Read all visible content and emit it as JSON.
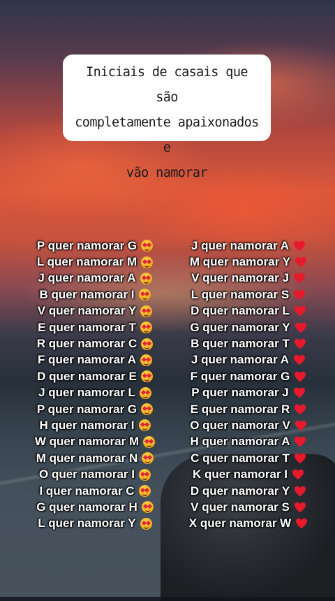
{
  "title": {
    "lines": [
      "Iniciais de casais que são",
      "completamente apaixonados e",
      "vão namorar"
    ]
  },
  "left_column": [
    {
      "text": "P quer namorar G",
      "icon": "heart-eyes-emoji-icon"
    },
    {
      "text": "L quer namorar M",
      "icon": "heart-eyes-emoji-icon"
    },
    {
      "text": "J quer namorar A",
      "icon": "heart-eyes-emoji-icon"
    },
    {
      "text": "B quer namorar I",
      "icon": "heart-eyes-emoji-icon"
    },
    {
      "text": "V quer namorar Y",
      "icon": "heart-eyes-emoji-icon"
    },
    {
      "text": "E quer namorar T",
      "icon": "heart-eyes-emoji-icon"
    },
    {
      "text": "R quer namorar C",
      "icon": "heart-eyes-emoji-icon"
    },
    {
      "text": "F quer namorar A",
      "icon": "heart-eyes-emoji-icon"
    },
    {
      "text": "D quer namorar E",
      "icon": "heart-eyes-emoji-icon"
    },
    {
      "text": "J quer namorar L",
      "icon": "heart-eyes-emoji-icon"
    },
    {
      "text": "P quer namorar G",
      "icon": "heart-eyes-emoji-icon"
    },
    {
      "text": "H quer namorar I",
      "icon": "heart-eyes-emoji-icon"
    },
    {
      "text": "W quer namorar M",
      "icon": "heart-eyes-emoji-icon"
    },
    {
      "text": "M quer namorar N",
      "icon": "heart-eyes-emoji-icon"
    },
    {
      "text": "O quer namorar I",
      "icon": "heart-eyes-emoji-icon"
    },
    {
      "text": "I quer namorar C",
      "icon": "heart-eyes-emoji-icon"
    },
    {
      "text": "G quer namorar H",
      "icon": "heart-eyes-emoji-icon"
    },
    {
      "text": "L quer namorar Y",
      "icon": "heart-eyes-emoji-icon"
    }
  ],
  "right_column": [
    {
      "text": "J quer namorar A",
      "icon": "red-heart-icon"
    },
    {
      "text": "M quer namorar Y",
      "icon": "red-heart-icon"
    },
    {
      "text": "V quer namorar J",
      "icon": "red-heart-icon"
    },
    {
      "text": "L quer namorar S",
      "icon": "red-heart-icon"
    },
    {
      "text": "D quer namorar L",
      "icon": "red-heart-icon"
    },
    {
      "text": "G quer namorar Y",
      "icon": "red-heart-icon"
    },
    {
      "text": "B quer namorar T",
      "icon": "red-heart-icon"
    },
    {
      "text": "J quer namorar A",
      "icon": "red-heart-icon"
    },
    {
      "text": "F quer namorar G",
      "icon": "red-heart-icon"
    },
    {
      "text": "P quer namorar J",
      "icon": "red-heart-icon"
    },
    {
      "text": "E quer namorar R",
      "icon": "red-heart-icon"
    },
    {
      "text": "O quer namorar V",
      "icon": "red-heart-icon"
    },
    {
      "text": "H quer namorar A",
      "icon": "red-heart-icon"
    },
    {
      "text": "C quer namorar T",
      "icon": "red-heart-icon"
    },
    {
      "text": "K quer namorar I",
      "icon": "red-heart-icon"
    },
    {
      "text": "D quer namorar Y",
      "icon": "red-heart-icon"
    },
    {
      "text": "V quer namorar S",
      "icon": "red-heart-icon"
    },
    {
      "text": "X quer namorar W",
      "icon": "red-heart-icon"
    }
  ],
  "colors": {
    "text": "#ffffff",
    "heart": "#e8192c",
    "title_bg": "#ffffff",
    "title_text": "#1a1a1a"
  }
}
